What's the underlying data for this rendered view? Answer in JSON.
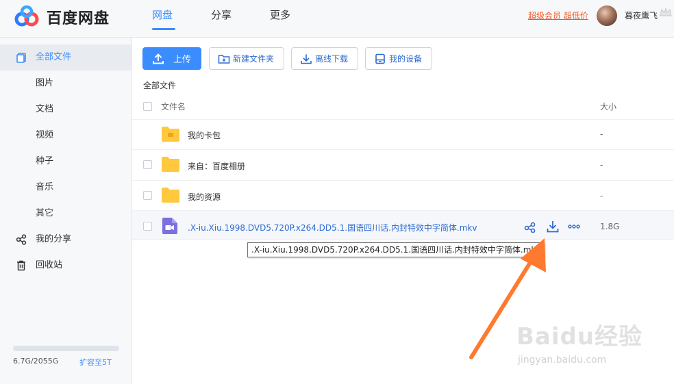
{
  "header": {
    "logo_text": "百度网盘",
    "nav": [
      "网盘",
      "分享",
      "更多"
    ],
    "vip_link": "超级会员 超低价",
    "username": "暮夜鹰飞"
  },
  "sidebar": {
    "items": [
      {
        "label": "全部文件",
        "icon": "files-icon"
      },
      {
        "label": "图片"
      },
      {
        "label": "文档"
      },
      {
        "label": "视频"
      },
      {
        "label": "种子"
      },
      {
        "label": "音乐"
      },
      {
        "label": "其它"
      },
      {
        "label": "我的分享",
        "icon": "share-icon"
      },
      {
        "label": "回收站",
        "icon": "trash-icon"
      }
    ],
    "quota_text": "6.7G/2055G",
    "expand_link": "扩容至5T"
  },
  "toolbar": {
    "upload": "上传",
    "new_folder": "新建文件夹",
    "offline_download": "离线下载",
    "my_devices": "我的设备"
  },
  "breadcrumb": "全部文件",
  "table": {
    "col_name": "文件名",
    "col_size": "大小",
    "rows": [
      {
        "name": "我的卡包",
        "size": "-",
        "icon": "card-folder-icon"
      },
      {
        "name": "来自：百度相册",
        "size": "-",
        "icon": "folder-icon"
      },
      {
        "name": "我的资源",
        "size": "-",
        "icon": "folder-icon"
      },
      {
        "name": ".X-iu.Xiu.1998.DVD5.720P.x264.DD5.1.国语四川话.内封特效中字简体.mkv",
        "size": "1.8G",
        "icon": "video-file-icon"
      }
    ]
  },
  "tooltip": ".X-iu.Xiu.1998.DVD5.720P.x264.DD5.1.国语四川话.内封特效中字简体.mkv",
  "watermark": {
    "brand": "Baidu经验",
    "url": "jingyan.baidu.com"
  },
  "colors": {
    "accent": "#3b8cff",
    "vip": "#f05a2a",
    "folder": "#ffc83d",
    "video": "#7c6fe0",
    "arrow": "#ff7a2e"
  }
}
